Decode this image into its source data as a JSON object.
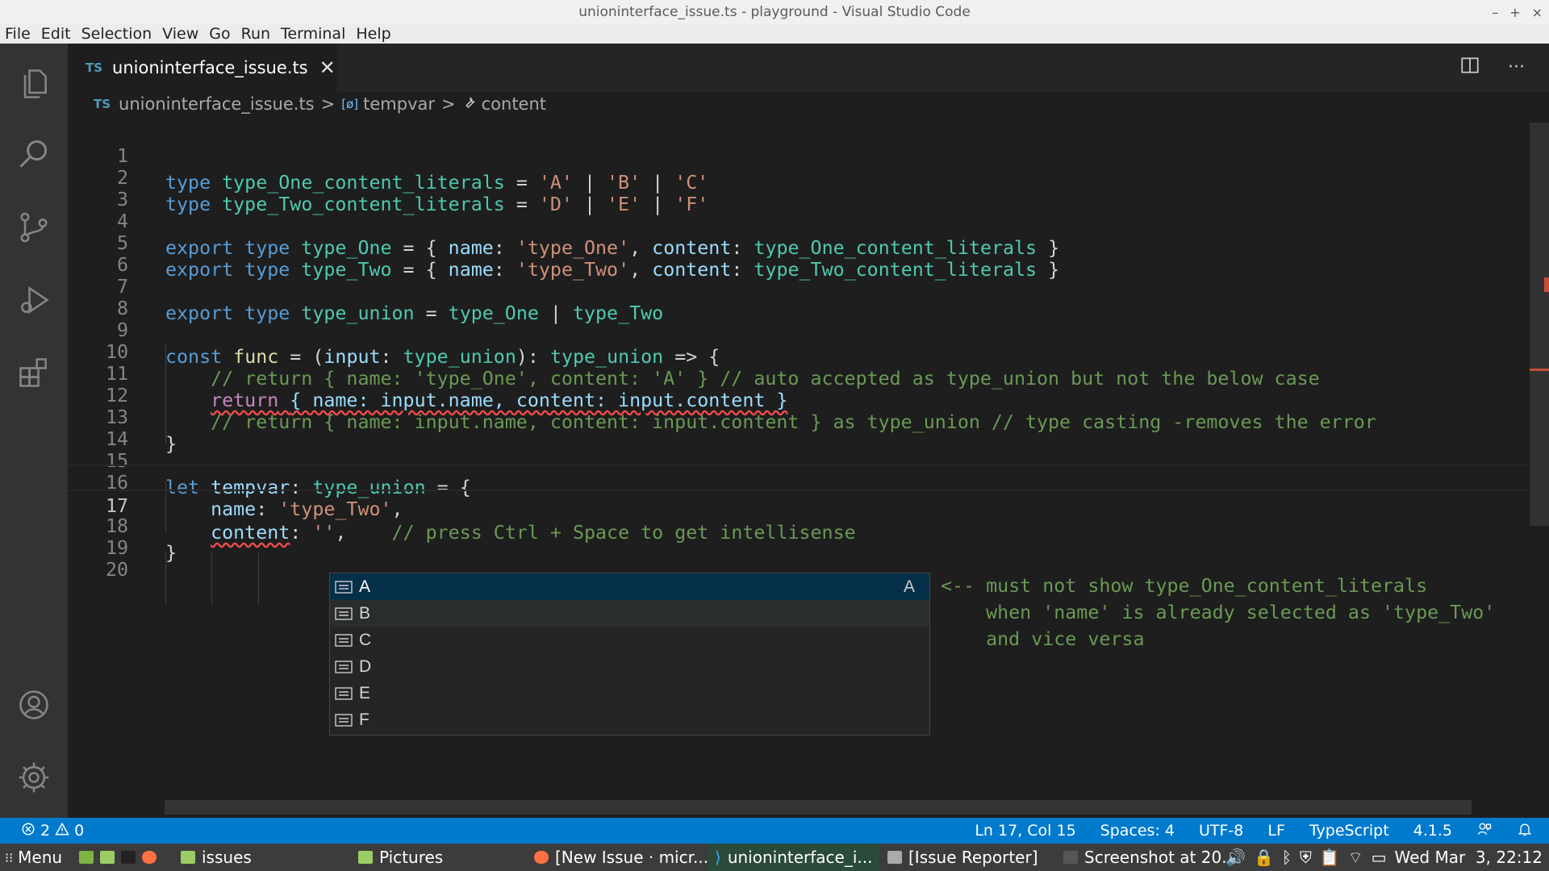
{
  "window": {
    "title": "unioninterface_issue.ts - playground - Visual Studio Code",
    "controls": [
      "–",
      "+",
      "×"
    ]
  },
  "menu": [
    "File",
    "Edit",
    "Selection",
    "View",
    "Go",
    "Run",
    "Terminal",
    "Help"
  ],
  "activity_bar": {
    "items": [
      "explorer-icon",
      "search-icon",
      "source-control-icon",
      "run-debug-icon",
      "extensions-icon"
    ],
    "bottom": [
      "accounts-icon",
      "manage-gear-icon"
    ]
  },
  "tab": {
    "lang_badge": "TS",
    "filename": "unioninterface_issue.ts",
    "close": "✕"
  },
  "tab_actions": {
    "split": "split-editor-icon",
    "more": "···"
  },
  "breadcrumb": {
    "lang_badge": "TS",
    "file": "unioninterface_issue.ts",
    "symbol1_icon": "[ø]",
    "symbol1": "tempvar",
    "symbol2_icon": "🔧",
    "symbol2": "content",
    "sep": ">"
  },
  "line_numbers": [
    "1",
    "2",
    "3",
    "4",
    "5",
    "6",
    "7",
    "8",
    "9",
    "10",
    "11",
    "12",
    "13",
    "14",
    "15",
    "16",
    "17",
    "18",
    "19",
    "20"
  ],
  "code": {
    "l1": [
      "type",
      " type_One_content_literals",
      " = ",
      "'A'",
      " | ",
      "'B'",
      " | ",
      "'C'"
    ],
    "l2": [
      "type",
      " type_Two_content_literals",
      " = ",
      "'D'",
      " | ",
      "'E'",
      " | ",
      "'F'"
    ],
    "l4": [
      "export",
      " type",
      " type_One",
      " = { ",
      "name",
      ": ",
      "'type_One'",
      ", ",
      "content",
      ": ",
      "type_One_content_literals",
      " }"
    ],
    "l5": [
      "export",
      " type",
      " type_Two",
      " = { ",
      "name",
      ": ",
      "'type_Two'",
      ", ",
      "content",
      ": ",
      "type_Two_content_literals",
      " }"
    ],
    "l7": [
      "export",
      " type",
      " type_union",
      " = ",
      "type_One",
      " | ",
      "type_Two"
    ],
    "l9": [
      "const",
      " func",
      " = (",
      "input",
      ": ",
      "type_union",
      "): ",
      "type_union",
      " => {"
    ],
    "l10": "    // return { name: 'type_One', content: 'A' } // auto accepted as type_union but not the below case",
    "l11": [
      "    ",
      "return",
      " ",
      "{ name: input.name, content: input.content }"
    ],
    "l12": "    // return { name: input.name, content: input.content } as type_union // type casting -removes the error",
    "l13": "}",
    "l15": [
      "let",
      " tempvar",
      ": ",
      "type_union",
      " = {"
    ],
    "l16": [
      "    ",
      "name",
      ": ",
      "'type_Two'",
      ","
    ],
    "l17": [
      "    ",
      "content",
      ": ",
      "''",
      ",",
      "    // press Ctrl + Space to get intellisense"
    ],
    "l18": "}"
  },
  "suggest": {
    "items": [
      "A",
      "B",
      "C",
      "D",
      "E",
      "F"
    ],
    "selected_detail": "A"
  },
  "note": "<-- must not show type_One_content_literals\n    when 'name' is already selected as 'type_Two'\n    and vice versa",
  "status": {
    "errors": "2",
    "warnings": "0",
    "cursor": "Ln 17, Col 15",
    "spaces": "Spaces: 4",
    "encoding": "UTF-8",
    "eol": "LF",
    "language": "TypeScript",
    "version": "4.1.5"
  },
  "taskbar": {
    "menu": "Menu",
    "items": [
      "issues",
      "Pictures",
      "[New Issue · micr...",
      "unioninterface_i...",
      "[Issue Reporter]",
      "Screenshot at 20..."
    ],
    "clock": "Wed Mar  3, 22:12"
  }
}
